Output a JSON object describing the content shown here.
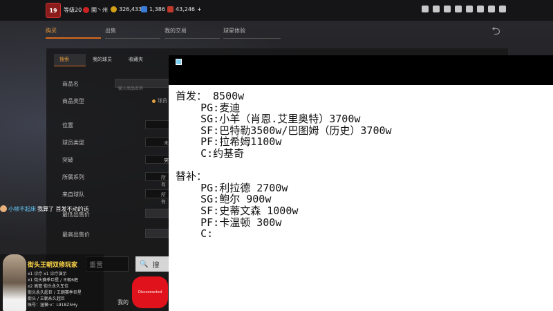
{
  "topbar": {
    "level": "等级20",
    "location": "闖丶州",
    "coins": "326,433",
    "points": "1,386",
    "vouchers": "43,246",
    "add_label": "+",
    "avatar_text": "19",
    "colors": {
      "bar": "#151517",
      "accent": "#e69a3c"
    }
  },
  "nav_tabs": [
    "购买",
    "出售",
    "我的交易",
    "球星体验"
  ],
  "sub_tabs": [
    "搜索",
    "我的球员",
    "收藏夹"
  ],
  "form": {
    "name_label": "商品名",
    "name_placeholder": "输入商品名称",
    "type_label": "商品类型",
    "type_value": "球员",
    "position_label": "位置",
    "player_type_label": "球员类型",
    "player_type_value": "未",
    "breakthrough_label": "突破",
    "breakthrough_value": "突",
    "series_label": "所属系列",
    "series_value": "所有",
    "team_label": "来自球队",
    "team_value": "所有",
    "min_price_label": "最低出售价",
    "max_price_label": "最高出售价"
  },
  "chat": {
    "user": "小帧不起床",
    "message": "我算了 首发不动的话"
  },
  "buttons": {
    "reset": "重置",
    "search": "搜"
  },
  "overlay": {
    "title": "街头王朝双修玩家",
    "lines": [
      "x1 诊疗   x1 诊疗演示",
      "x1 街头赛季巨星 / 王朝6把",
      "x2 高管·街头永久车位",
      "街头永久超巨 / 王朝赛季巨星",
      "街头 / 王朝永久超巨",
      "账号：涵薇·v：L918Z5Hy"
    ],
    "controller_label": "Disconnected"
  },
  "bottom_text": "我的",
  "notepad": {
    "lines": [
      "首发： 8500w",
      "    PG:麦迪",
      "    SG:小羊（肖恩.艾里奥特）3700w",
      "    SF:巴特勒3500w/巴图姆（历史）3700w",
      "    PF:拉希姆1100w",
      "    C:约基奇",
      "",
      "替补：",
      "    PG:利拉德 2700w",
      "    SG:鲍尔 900w",
      "    SF:史蒂文森 1000w",
      "    PF:卡温顿 300w",
      "    C:"
    ]
  }
}
